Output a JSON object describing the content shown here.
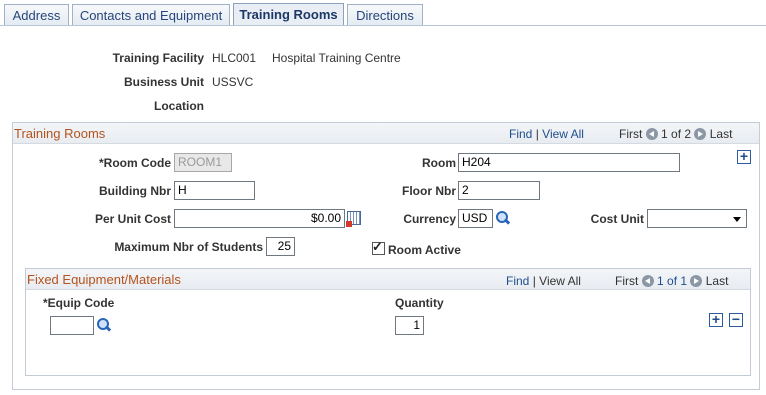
{
  "tabs": [
    {
      "label": "Address"
    },
    {
      "label": "Contacts and Equipment"
    },
    {
      "label": "Training Rooms",
      "active": true
    },
    {
      "label": "Directions"
    }
  ],
  "header": {
    "facility_label": "Training Facility",
    "facility_code": "HLC001",
    "facility_name": "Hospital Training Centre",
    "bu_label": "Business Unit",
    "bu_value": "USSVC",
    "location_label": "Location"
  },
  "rooms": {
    "title": "Training Rooms",
    "nav": {
      "find": "Find",
      "sep": "|",
      "view_all": "View All",
      "first": "First",
      "pos": "1 of 2",
      "last": "Last"
    },
    "room_code_label": "*Room Code",
    "room_code_value": "ROOM1",
    "room_label": "Room",
    "room_value": "H204",
    "building_label": "Building Nbr",
    "building_value": "H",
    "floor_label": "Floor Nbr",
    "floor_value": "2",
    "cost_label": "Per Unit Cost",
    "cost_value": "$0.00",
    "currency_label": "Currency",
    "currency_value": "USD",
    "cost_unit_label": "Cost Unit",
    "cost_unit_value": "",
    "max_label": "Maximum Nbr of Students",
    "max_value": "25",
    "active_label": "Room Active",
    "active_checked": true,
    "add_symbol": "+"
  },
  "equipment": {
    "title": "Fixed Equipment/Materials",
    "nav": {
      "find": "Find",
      "sep": "|",
      "view_all": "View All",
      "first": "First",
      "pos": "1 of 1",
      "last": "Last"
    },
    "col_code": "*Equip Code",
    "col_qty": "Quantity",
    "code_value": "",
    "qty_value": "1",
    "add_symbol": "+",
    "remove_symbol": "−"
  }
}
